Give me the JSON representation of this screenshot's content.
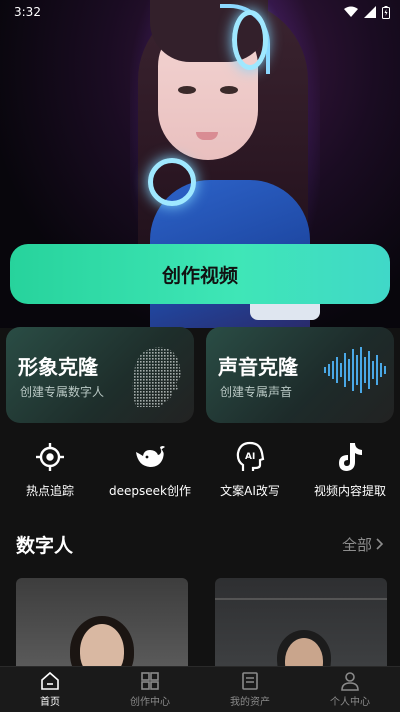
{
  "status_bar": {
    "time": "3:32"
  },
  "hero": {
    "create_button_label": "创作视频"
  },
  "feature_cards": [
    {
      "title": "形象克隆",
      "subtitle": "创建专属数字人"
    },
    {
      "title": "声音克隆",
      "subtitle": "创建专属声音"
    }
  ],
  "tools": [
    {
      "label": "热点追踪",
      "icon": "crosshair-icon"
    },
    {
      "label": "deepseek创作",
      "icon": "whale-icon"
    },
    {
      "label": "文案AI改写",
      "icon": "ai-head-icon"
    },
    {
      "label": "视频内容提取",
      "icon": "tiktok-icon"
    }
  ],
  "digital_human": {
    "title": "数字人",
    "see_all": "全部"
  },
  "tab_bar": {
    "active_index": 0,
    "items": [
      {
        "label": "首页",
        "icon": "home-icon"
      },
      {
        "label": "创作中心",
        "icon": "grid-icon"
      },
      {
        "label": "我的资产",
        "icon": "assets-icon"
      },
      {
        "label": "个人中心",
        "icon": "user-icon"
      }
    ]
  },
  "colors": {
    "accent": "#2fdcaa",
    "background": "#121212"
  }
}
